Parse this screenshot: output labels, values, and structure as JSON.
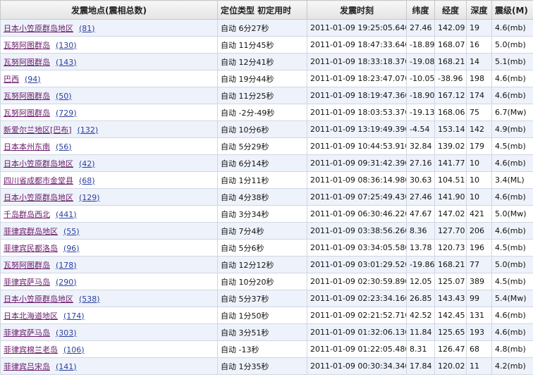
{
  "headers": [
    "发震地点(震相总数)",
    "定位类型  初定用时",
    "发震时刻",
    "纬度",
    "经度",
    "深度",
    "震级(M)"
  ],
  "rows": [
    {
      "place": "日本小笠原群岛地区",
      "count": "(81)",
      "type_time": "自动 6分27秒",
      "origin_time": "2011-01-09 19:25:05.640",
      "lat": "27.46",
      "lon": "142.09",
      "depth": "19",
      "mag": "4.6(mb)"
    },
    {
      "place": "瓦努阿图群岛",
      "count": "(130)",
      "type_time": "自动 11分45秒",
      "origin_time": "2011-01-09 18:47:33.640",
      "lat": "-18.89",
      "lon": "168.07",
      "depth": "16",
      "mag": "5.0(mb)"
    },
    {
      "place": "瓦努阿图群岛",
      "count": "(143)",
      "type_time": "自动 12分41秒",
      "origin_time": "2011-01-09 18:33:18.370",
      "lat": "-19.08",
      "lon": "168.21",
      "depth": "14",
      "mag": "5.1(mb)"
    },
    {
      "place": "巴西",
      "count": "(94)",
      "type_time": "自动 19分44秒",
      "origin_time": "2011-01-09 18:23:47.070",
      "lat": "-10.05",
      "lon": "-38.96",
      "depth": "198",
      "mag": "4.6(mb)"
    },
    {
      "place": "瓦努阿图群岛",
      "count": "(50)",
      "type_time": "自动 11分25秒",
      "origin_time": "2011-01-09 18:19:47.360",
      "lat": "-18.90",
      "lon": "167.12",
      "depth": "174",
      "mag": "4.6(mb)"
    },
    {
      "place": "瓦努阿图群岛",
      "count": "(729)",
      "type_time": "自动 -2分-49秒",
      "origin_time": "2011-01-09 18:03:53.370",
      "lat": "-19.13",
      "lon": "168.06",
      "depth": "75",
      "mag": "6.7(Mw)"
    },
    {
      "place": "新爱尔兰地区[巴布]",
      "count": "(132)",
      "type_time": "自动 10分6秒",
      "origin_time": "2011-01-09 13:19:49.390",
      "lat": "-4.54",
      "lon": "153.14",
      "depth": "142",
      "mag": "4.9(mb)"
    },
    {
      "place": "日本本州东南",
      "count": "(56)",
      "type_time": "自动 5分29秒",
      "origin_time": "2011-01-09 10:44:53.910",
      "lat": "32.84",
      "lon": "139.02",
      "depth": "179",
      "mag": "4.5(mb)"
    },
    {
      "place": "日本小笠原群岛地区",
      "count": "(42)",
      "type_time": "自动 6分14秒",
      "origin_time": "2011-01-09 09:31:42.390",
      "lat": "27.16",
      "lon": "141.77",
      "depth": "10",
      "mag": "4.6(mb)"
    },
    {
      "place": "四川省成都市金堂县",
      "count": "(68)",
      "type_time": "自动 1分11秒",
      "origin_time": "2011-01-09 08:36:14.980",
      "lat": "30.63",
      "lon": "104.51",
      "depth": "10",
      "mag": "3.4(ML)"
    },
    {
      "place": "日本小笠原群岛地区",
      "count": "(129)",
      "type_time": "自动 4分38秒",
      "origin_time": "2011-01-09 07:25:49.430",
      "lat": "27.46",
      "lon": "141.90",
      "depth": "10",
      "mag": "4.6(mb)"
    },
    {
      "place": "千岛群岛西北",
      "count": "(441)",
      "type_time": "自动 3分34秒",
      "origin_time": "2011-01-09 06:30:46.220",
      "lat": "47.67",
      "lon": "147.02",
      "depth": "421",
      "mag": "5.0(Mw)"
    },
    {
      "place": "菲律宾群岛地区",
      "count": "(55)",
      "type_time": "自动 7分4秒",
      "origin_time": "2011-01-09 03:38:56.260",
      "lat": "8.36",
      "lon": "127.70",
      "depth": "206",
      "mag": "4.6(mb)"
    },
    {
      "place": "菲律宾民都洛岛",
      "count": "(96)",
      "type_time": "自动 5分6秒",
      "origin_time": "2011-01-09 03:34:05.580",
      "lat": "13.78",
      "lon": "120.73",
      "depth": "196",
      "mag": "4.5(mb)"
    },
    {
      "place": "瓦努阿图群岛",
      "count": "(178)",
      "type_time": "自动 12分12秒",
      "origin_time": "2011-01-09 03:01:29.520",
      "lat": "-19.86",
      "lon": "168.21",
      "depth": "77",
      "mag": "5.0(mb)"
    },
    {
      "place": "菲律宾萨马岛",
      "count": "(290)",
      "type_time": "自动 10分20秒",
      "origin_time": "2011-01-09 02:30:59.890",
      "lat": "12.05",
      "lon": "125.07",
      "depth": "389",
      "mag": "4.5(mb)"
    },
    {
      "place": "日本小笠原群岛地区",
      "count": "(538)",
      "type_time": "自动 5分37秒",
      "origin_time": "2011-01-09 02:23:34.160",
      "lat": "26.85",
      "lon": "143.43",
      "depth": "99",
      "mag": "5.4(Mw)"
    },
    {
      "place": "日本北海道地区",
      "count": "(174)",
      "type_time": "自动 1分50秒",
      "origin_time": "2011-01-09 02:21:52.710",
      "lat": "42.52",
      "lon": "142.45",
      "depth": "131",
      "mag": "4.6(mb)"
    },
    {
      "place": "菲律宾萨马岛",
      "count": "(303)",
      "type_time": "自动 3分51秒",
      "origin_time": "2011-01-09 01:32:06.130",
      "lat": "11.84",
      "lon": "125.65",
      "depth": "193",
      "mag": "4.6(mb)"
    },
    {
      "place": "菲律宾棉兰老岛",
      "count": "(106)",
      "type_time": "自动 -13秒",
      "origin_time": "2011-01-09 01:22:05.480",
      "lat": "8.31",
      "lon": "126.47",
      "depth": "68",
      "mag": "4.8(mb)"
    },
    {
      "place": "菲律宾吕宋岛",
      "count": "(141)",
      "type_time": "自动 1分35秒",
      "origin_time": "2011-01-09 00:30:34.340",
      "lat": "17.84",
      "lon": "120.02",
      "depth": "11",
      "mag": "4.2(mb)"
    }
  ]
}
